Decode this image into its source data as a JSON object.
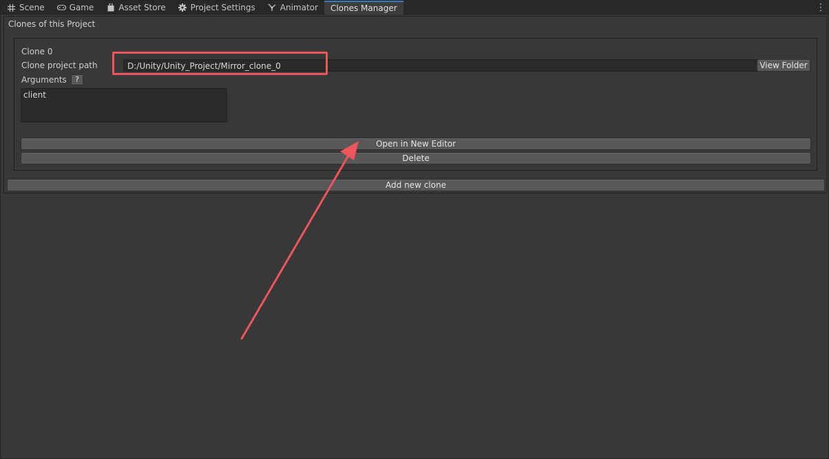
{
  "tabs": [
    {
      "label": "Scene",
      "icon": "grid-icon",
      "active": false
    },
    {
      "label": "Game",
      "icon": "gamepad-icon",
      "active": false
    },
    {
      "label": "Asset Store",
      "icon": "shopping-bag-icon",
      "active": false
    },
    {
      "label": "Project Settings",
      "icon": "gear-icon",
      "active": false
    },
    {
      "label": "Animator",
      "icon": "animator-icon",
      "active": false
    },
    {
      "label": "Clones Manager",
      "icon": "",
      "active": true
    }
  ],
  "panel": {
    "title": "Clones of this Project",
    "clone": {
      "name": "Clone 0",
      "path_label": "Clone project path",
      "path_value": "D:/Unity/Unity_Project/Mirror_clone_0",
      "view_folder_label": "View Folder",
      "arguments_label": "Arguments",
      "help_label": "?",
      "arguments_value": "client",
      "open_label": "Open in New Editor",
      "delete_label": "Delete"
    },
    "add_label": "Add new clone"
  },
  "annotation": {
    "color": "#f0545c"
  },
  "colors": {
    "background": "#383838",
    "tabbar": "#282828",
    "button": "#585858",
    "field": "#2a2a2a",
    "active_tab_accent": "#3a79bb"
  }
}
